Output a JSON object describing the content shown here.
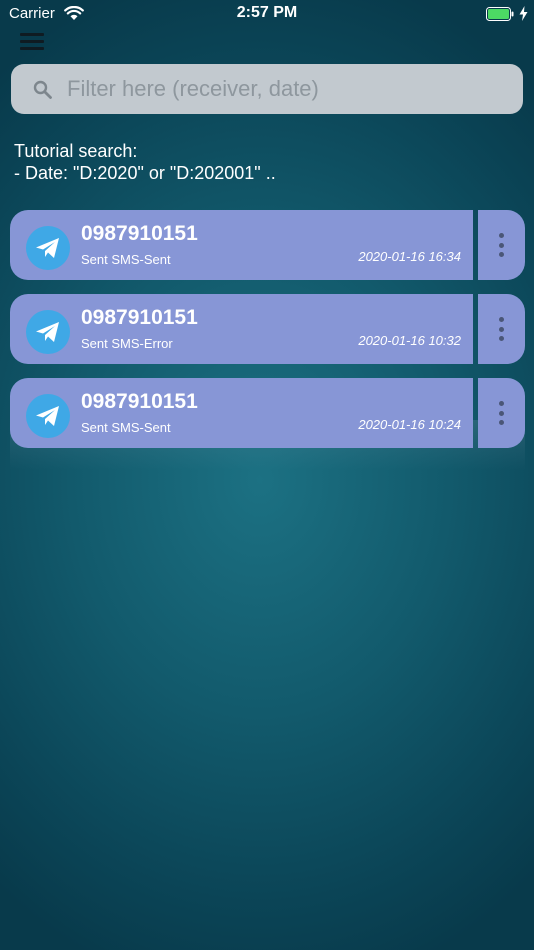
{
  "status_bar": {
    "carrier": "Carrier",
    "time": "2:57 PM",
    "battery_color": "#4cd964"
  },
  "top_bar": {
    "menu_icon": "hamburger-icon"
  },
  "search": {
    "placeholder": "Filter here (receiver, date)",
    "value": ""
  },
  "tutorial": {
    "line1": "Tutorial search:",
    "line2": "- Date: \"D:2020\" or \"D:202001\" .."
  },
  "messages": [
    {
      "receiver": "0987910151",
      "status": "Sent SMS-Sent",
      "date": "2020-01-16 16:34"
    },
    {
      "receiver": "0987910151",
      "status": "Sent SMS-Error",
      "date": "2020-01-16 10:32"
    },
    {
      "receiver": "0987910151",
      "status": "Sent SMS-Sent",
      "date": "2020-01-16 10:24"
    }
  ],
  "colors": {
    "card": "#8796d6",
    "avatar": "#3fa8e6",
    "search_bg": "#c2c9cf"
  }
}
